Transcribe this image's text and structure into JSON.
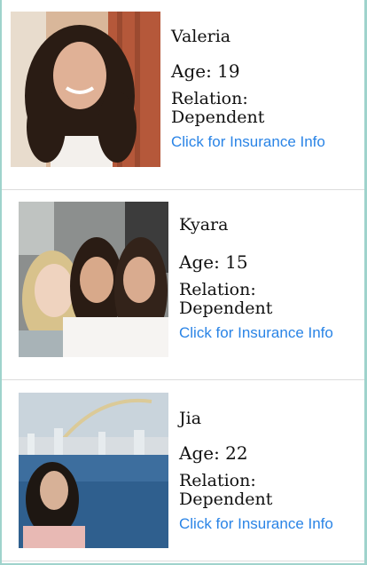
{
  "profiles": [
    {
      "name": "Valeria",
      "age_text": "Age: 19",
      "relation_label": "Relation:",
      "relation_value": "Dependent",
      "link_text": "Click for Insurance Info",
      "photo_icon": "portrait-photo"
    },
    {
      "name": "Kyara",
      "age_text": "Age: 15",
      "relation_label": "Relation:",
      "relation_value": "Dependent",
      "link_text": "Click for Insurance Info",
      "photo_icon": "group-selfie-photo"
    },
    {
      "name": "Jia",
      "age_text": "Age: 22",
      "relation_label": "Relation:",
      "relation_value": "Dependent",
      "link_text": "Click for Insurance Info",
      "photo_icon": "waterfront-portrait-photo"
    }
  ],
  "colors": {
    "link": "#2a84e6",
    "text": "#111111",
    "divider": "#dcdcdc",
    "frame": "#9fd3cc"
  }
}
